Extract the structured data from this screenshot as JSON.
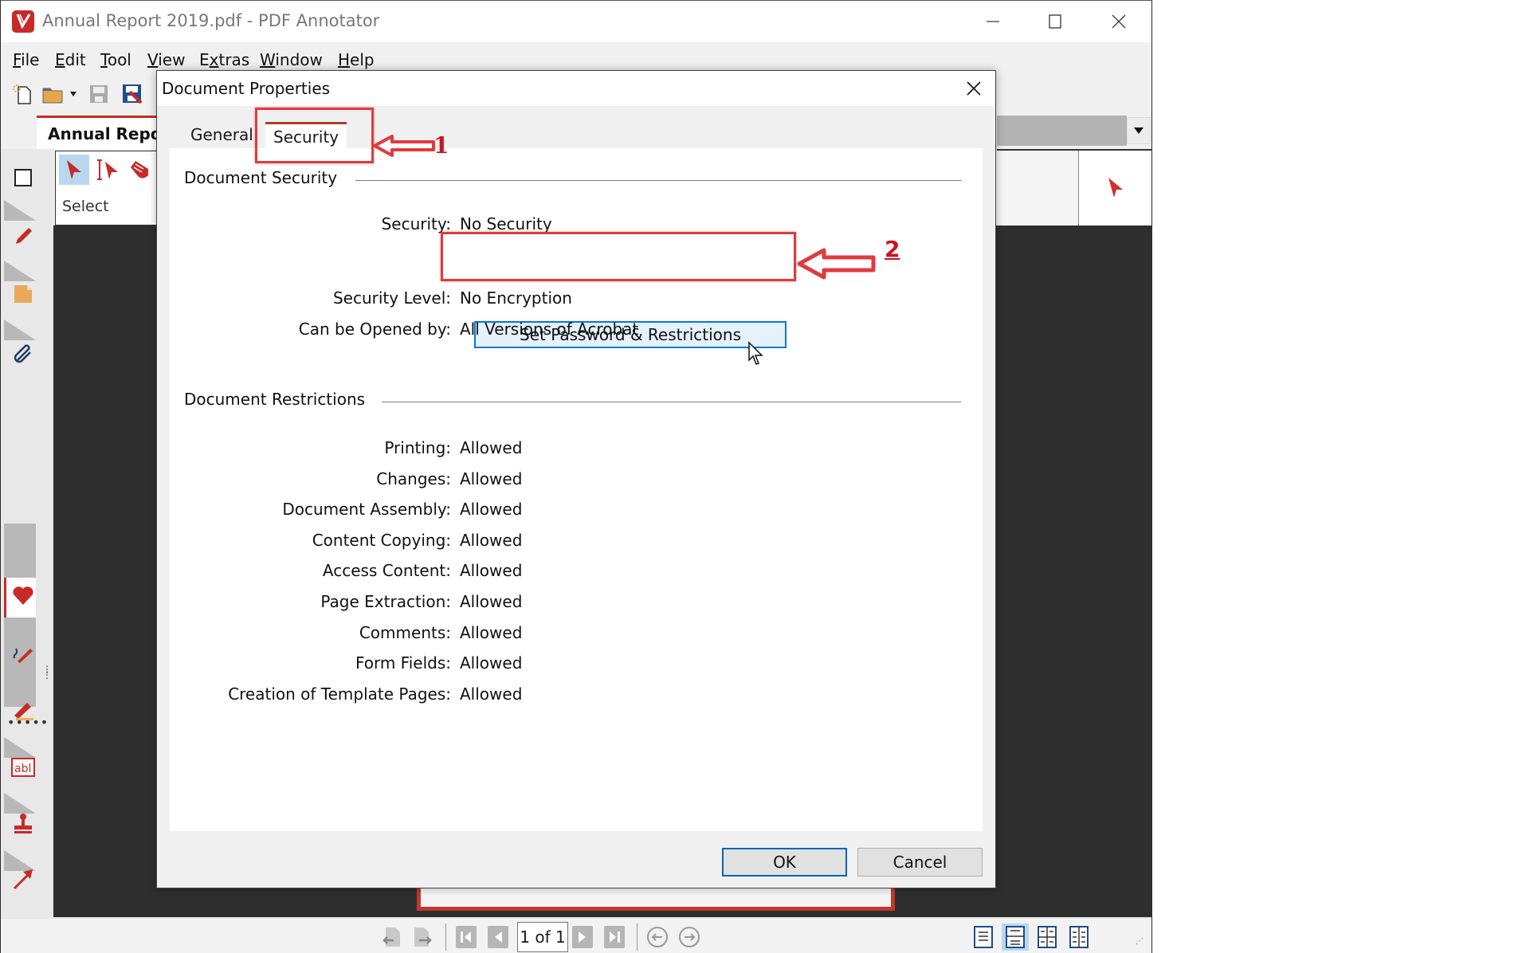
{
  "window": {
    "title": "Annual Report 2019.pdf - PDF Annotator",
    "controls": [
      "minimize",
      "maximize",
      "close"
    ]
  },
  "menu": {
    "items": [
      {
        "label": "File",
        "mnemonic": "F"
      },
      {
        "label": "Edit",
        "mnemonic": "E"
      },
      {
        "label": "Tool",
        "mnemonic": "T"
      },
      {
        "label": "View",
        "mnemonic": "V"
      },
      {
        "label": "Extras",
        "mnemonic": "x"
      },
      {
        "label": "Window",
        "mnemonic": "W"
      },
      {
        "label": "Help",
        "mnemonic": "H"
      }
    ]
  },
  "toolbar": {
    "icons": [
      "new-document-icon",
      "open-folder-icon",
      "open-dropdown-icon",
      "save-icon",
      "save-annotated-icon"
    ]
  },
  "document_tab": {
    "label": "Annual Report"
  },
  "select_ribbon": {
    "label": "Select",
    "tools": [
      "select-arrow-icon",
      "text-select-icon",
      "hand-pan-icon"
    ]
  },
  "left_strip": {
    "icons": [
      "checkbox-icon",
      "pen-icon",
      "note-icon",
      "paperclip-icon",
      "favorites-heart-icon",
      "freehand-pen-icon",
      "highlighter-icon",
      "text-field-icon",
      "stamp-icon",
      "arrow-icon"
    ]
  },
  "status_bar": {
    "page_indicator": "1 of 1",
    "nav": [
      "prev-document-icon",
      "next-document-icon",
      "first-page-icon",
      "prev-page-icon",
      "next-page-icon",
      "last-page-icon",
      "back-icon",
      "forward-icon"
    ],
    "view_modes": [
      "single-page-view",
      "continuous-view",
      "two-page-view",
      "book-view"
    ],
    "active_view_mode": "continuous-view"
  },
  "dialog": {
    "title": "Document Properties",
    "tabs": [
      {
        "label": "General",
        "active": false
      },
      {
        "label": "Security",
        "active": true
      }
    ],
    "security_section": {
      "heading": "Document Security",
      "rows": [
        {
          "label": "Security:",
          "value": "No Security"
        },
        {
          "label": "Security Level:",
          "value": "No Encryption"
        },
        {
          "label": "Can be Opened by:",
          "value": "All Versions of Acrobat"
        }
      ],
      "button_label": "Set Password & Restrictions"
    },
    "restrictions_section": {
      "heading": "Document Restrictions",
      "rows": [
        {
          "label": "Printing:",
          "value": "Allowed"
        },
        {
          "label": "Changes:",
          "value": "Allowed"
        },
        {
          "label": "Document Assembly:",
          "value": "Allowed"
        },
        {
          "label": "Content Copying:",
          "value": "Allowed"
        },
        {
          "label": "Access Content:",
          "value": "Allowed"
        },
        {
          "label": "Page Extraction:",
          "value": "Allowed"
        },
        {
          "label": "Comments:",
          "value": "Allowed"
        },
        {
          "label": "Form Fields:",
          "value": "Allowed"
        },
        {
          "label": "Creation of Template Pages:",
          "value": "Allowed"
        }
      ]
    },
    "ok_label": "OK",
    "cancel_label": "Cancel"
  },
  "annotations": {
    "step1": "1",
    "step2": "2",
    "color": "#e03a3e"
  },
  "colors": {
    "brand_red": "#c62b28",
    "accent_blue": "#0078d7",
    "doc_background": "#2e2e2e"
  }
}
